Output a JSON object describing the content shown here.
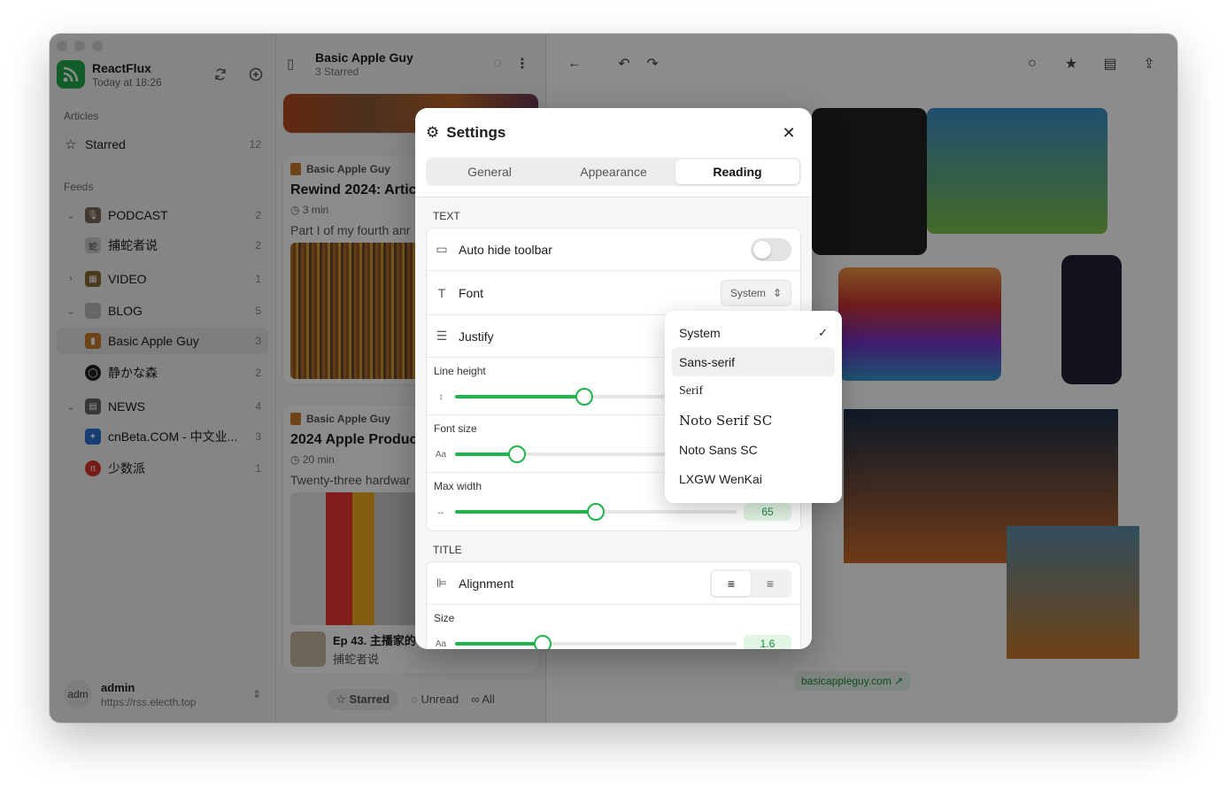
{
  "app": {
    "name": "ReactFlux",
    "subtitle": "Today at 18:26"
  },
  "sidebar": {
    "articles_label": "Articles",
    "starred": {
      "label": "Starred",
      "count": "12"
    },
    "feeds_label": "Feeds",
    "items": [
      {
        "label": "PODCAST",
        "count": "2",
        "type": "category",
        "expanded": true
      },
      {
        "label": "捕蛇者说",
        "count": "2",
        "type": "feed"
      },
      {
        "label": "VIDEO",
        "count": "1",
        "type": "category",
        "expanded": false
      },
      {
        "label": "BLOG",
        "count": "5",
        "type": "category",
        "expanded": true
      },
      {
        "label": "Basic Apple Guy",
        "count": "3",
        "type": "feed",
        "selected": true
      },
      {
        "label": "静かな森",
        "count": "2",
        "type": "feed"
      },
      {
        "label": "NEWS",
        "count": "4",
        "type": "category",
        "expanded": true
      },
      {
        "label": "cnBeta.COM - 中文业...",
        "count": "3",
        "type": "feed"
      },
      {
        "label": "少数派",
        "count": "1",
        "type": "feed"
      }
    ],
    "user": {
      "avatar": "adm",
      "name": "admin",
      "url": "https://rss.electh.top"
    }
  },
  "list": {
    "title": "Basic Apple Guy",
    "subtitle": "3 Starred",
    "cards": [
      {
        "feed": "Basic Apple Guy",
        "title": "Rewind 2024: Artic",
        "time": "3 min",
        "excerpt": "Part I of my fourth anr"
      },
      {
        "feed": "Basic Apple Guy",
        "title": "2024 Apple Produc",
        "time": "20 min",
        "excerpt": "Twenty-three hardwar"
      }
    ],
    "mini": {
      "title": "Ep 43. 主播家的",
      "feed": "捕蛇者说"
    },
    "filters": {
      "starred": "Starred",
      "unread": "Unread",
      "all": "All"
    }
  },
  "reader": {
    "link": "basicappleguy.com"
  },
  "settings": {
    "title": "Settings",
    "tabs": [
      "General",
      "Appearance",
      "Reading"
    ],
    "active_tab": "Reading",
    "text_section": "TEXT",
    "auto_hide": "Auto hide toolbar",
    "font_label": "Font",
    "font_value": "System",
    "justify_label": "Justify",
    "line_height": {
      "label": "Line height",
      "fraction": 0.46
    },
    "font_size": {
      "label": "Font size",
      "fraction": 0.22
    },
    "max_width": {
      "label": "Max width",
      "value": "65",
      "fraction": 0.5
    },
    "title_section": "TITLE",
    "alignment_label": "Alignment",
    "size": {
      "label": "Size",
      "value": "1.6",
      "fraction": 0.31
    }
  },
  "font_options": [
    {
      "label": "System",
      "checked": true
    },
    {
      "label": "Sans-serif",
      "highlighted": true
    },
    {
      "label": "Serif"
    },
    {
      "label": "Noto Serif SC"
    },
    {
      "label": "Noto Sans SC"
    },
    {
      "label": "LXGW WenKai"
    }
  ]
}
